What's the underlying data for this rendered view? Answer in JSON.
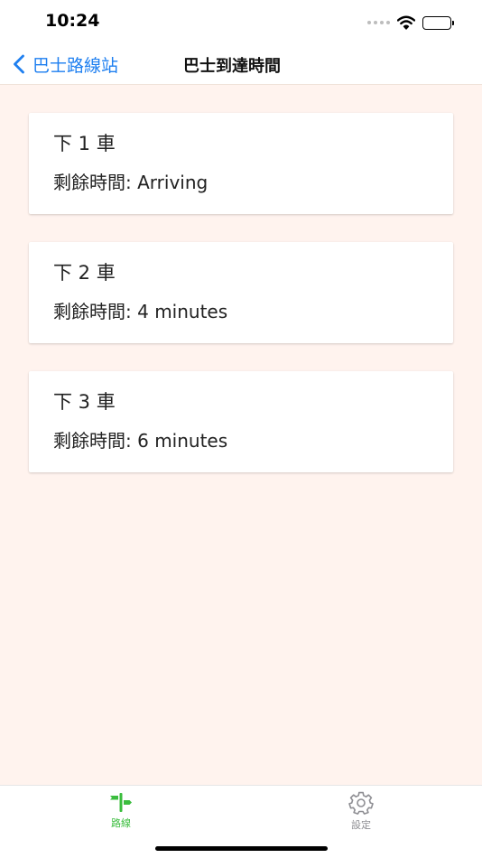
{
  "status_bar": {
    "time": "10:24",
    "icons": [
      "signal-dots-icon",
      "wifi-icon",
      "battery-icon"
    ]
  },
  "nav": {
    "back_label": "巴士路線站",
    "title": "巴士到達時間",
    "back_icon": "chevron-left-icon"
  },
  "arrivals": [
    {
      "title": "下 1 車",
      "remaining_label": "剩餘時間",
      "remaining": "Arriving"
    },
    {
      "title": "下 2 車",
      "remaining_label": "剩餘時間",
      "remaining": "4 minutes"
    },
    {
      "title": "下 3 車",
      "remaining_label": "剩餘時間",
      "remaining": "6 minutes"
    }
  ],
  "tabs": [
    {
      "label": "路線",
      "icon": "signpost-icon",
      "selected": true
    },
    {
      "label": "設定",
      "icon": "gear-icon",
      "selected": false
    }
  ],
  "colors": {
    "accent": "#1e7ff0",
    "tab_active": "#3bbd3e",
    "tab_inactive": "#8e8e93",
    "content_background": "#fff3ee",
    "card_background": "#ffffff"
  }
}
